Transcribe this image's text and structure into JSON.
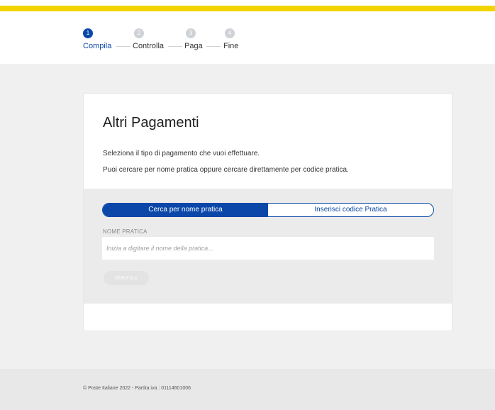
{
  "stepper": {
    "steps": [
      {
        "number": "1",
        "label": "Compila",
        "active": true
      },
      {
        "number": "2",
        "label": "Controlla",
        "active": false
      },
      {
        "number": "3",
        "label": "Paga",
        "active": false
      },
      {
        "number": "4",
        "label": "Fine",
        "active": false
      }
    ]
  },
  "card": {
    "title": "Altri Pagamenti",
    "desc1": "Seleziona il tipo di pagamento che vuoi effettuare.",
    "desc2": "Puoi cercare per nome pratica oppure cercare direttamente per codice pratica."
  },
  "search": {
    "toggle_left": "Cerca per nome pratica",
    "toggle_right": "Inserisci codice Pratica",
    "field_label": "NOME PRATICA",
    "field_placeholder": "Inizia a digitare il nome della pratica...",
    "field_value": "",
    "verify_label": "VERIFICA"
  },
  "footer": {
    "text": "© Poste Italiane 2022 - Partita iva : 01114601006"
  },
  "colors": {
    "brand_yellow": "#f2d500",
    "primary_blue": "#0a47a9"
  }
}
